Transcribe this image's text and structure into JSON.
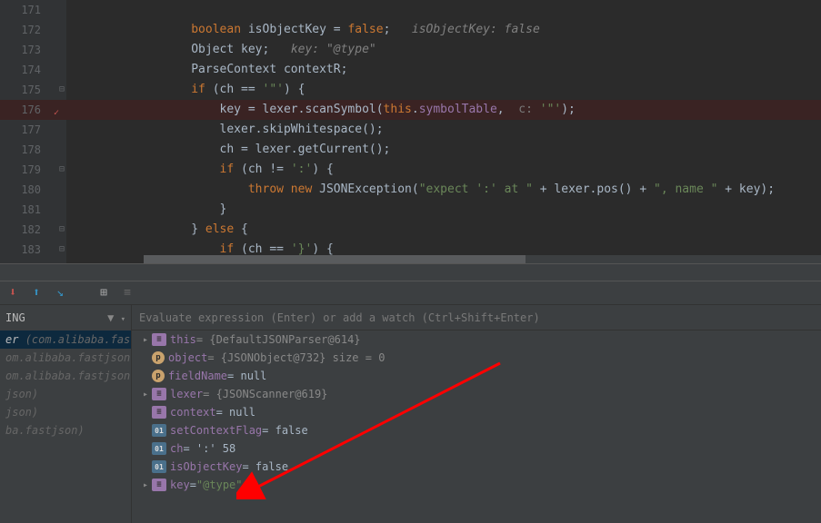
{
  "editor": {
    "lines": [
      {
        "n": "171",
        "code": ""
      },
      {
        "n": "172",
        "code": "                boolean isObjectKey = false;",
        "hint": "isObjectKey: false"
      },
      {
        "n": "173",
        "code": "                Object key;",
        "hint": "key: \"@type\""
      },
      {
        "n": "174",
        "code": "                ParseContext contextR;"
      },
      {
        "n": "175",
        "code": "                if (ch == '\"') {"
      },
      {
        "n": "176",
        "code": "                    key = lexer.scanSymbol(this.symbolTable, ",
        "tail": "'\"');",
        "bp": true,
        "hl": true,
        "hint2": "c: "
      },
      {
        "n": "177",
        "code": "                    lexer.skipWhitespace();"
      },
      {
        "n": "178",
        "code": "                    ch = lexer.getCurrent();"
      },
      {
        "n": "179",
        "code": "                    if (ch != ':') {"
      },
      {
        "n": "180",
        "code": "                        throw new JSONException(\"expect ':' at \" + lexer.pos() + \", name \" + key);"
      },
      {
        "n": "181",
        "code": "                    }"
      },
      {
        "n": "182",
        "code": "                } else {"
      },
      {
        "n": "183",
        "code": "                    if (ch == '}') {"
      }
    ]
  },
  "frames": {
    "header": "ING",
    "items": [
      {
        "txt": "er",
        "pkg": "(com.alibaba.fastjson.",
        "sel": true
      },
      {
        "txt": "",
        "pkg": "om.alibaba.fastjson.parse"
      },
      {
        "txt": "",
        "pkg": "om.alibaba.fastjson.parse"
      },
      {
        "txt": "",
        "pkg": "json)"
      },
      {
        "txt": "",
        "pkg": "json)"
      },
      {
        "txt": "",
        "pkg": "ba.fastjson)"
      }
    ]
  },
  "eval_placeholder": "Evaluate expression (Enter) or add a watch (Ctrl+Shift+Enter)",
  "vars": [
    {
      "arrow": true,
      "icon": "obj",
      "name": "this",
      "val": " = {DefaultJSONParser@614}"
    },
    {
      "arrow": false,
      "indent": 1,
      "icon": "p",
      "name": "object",
      "val": " = {JSONObject@732}  size = 0"
    },
    {
      "arrow": false,
      "indent": 1,
      "icon": "p",
      "name": "fieldName",
      "val": " = null"
    },
    {
      "arrow": true,
      "icon": "obj",
      "name": "lexer",
      "val": " = {JSONScanner@619}"
    },
    {
      "arrow": false,
      "indent": 1,
      "icon": "obj",
      "name": "context",
      "val": " = null"
    },
    {
      "arrow": false,
      "indent": 1,
      "icon": "01",
      "name": "setContextFlag",
      "val": " = false"
    },
    {
      "arrow": false,
      "indent": 1,
      "icon": "01",
      "name": "ch",
      "val": " = ':' 58"
    },
    {
      "arrow": false,
      "indent": 1,
      "icon": "01",
      "name": "isObjectKey",
      "val": " = false"
    },
    {
      "arrow": true,
      "icon": "obj",
      "name": "key",
      "val": " = ",
      "str": "\"@type\""
    }
  ]
}
